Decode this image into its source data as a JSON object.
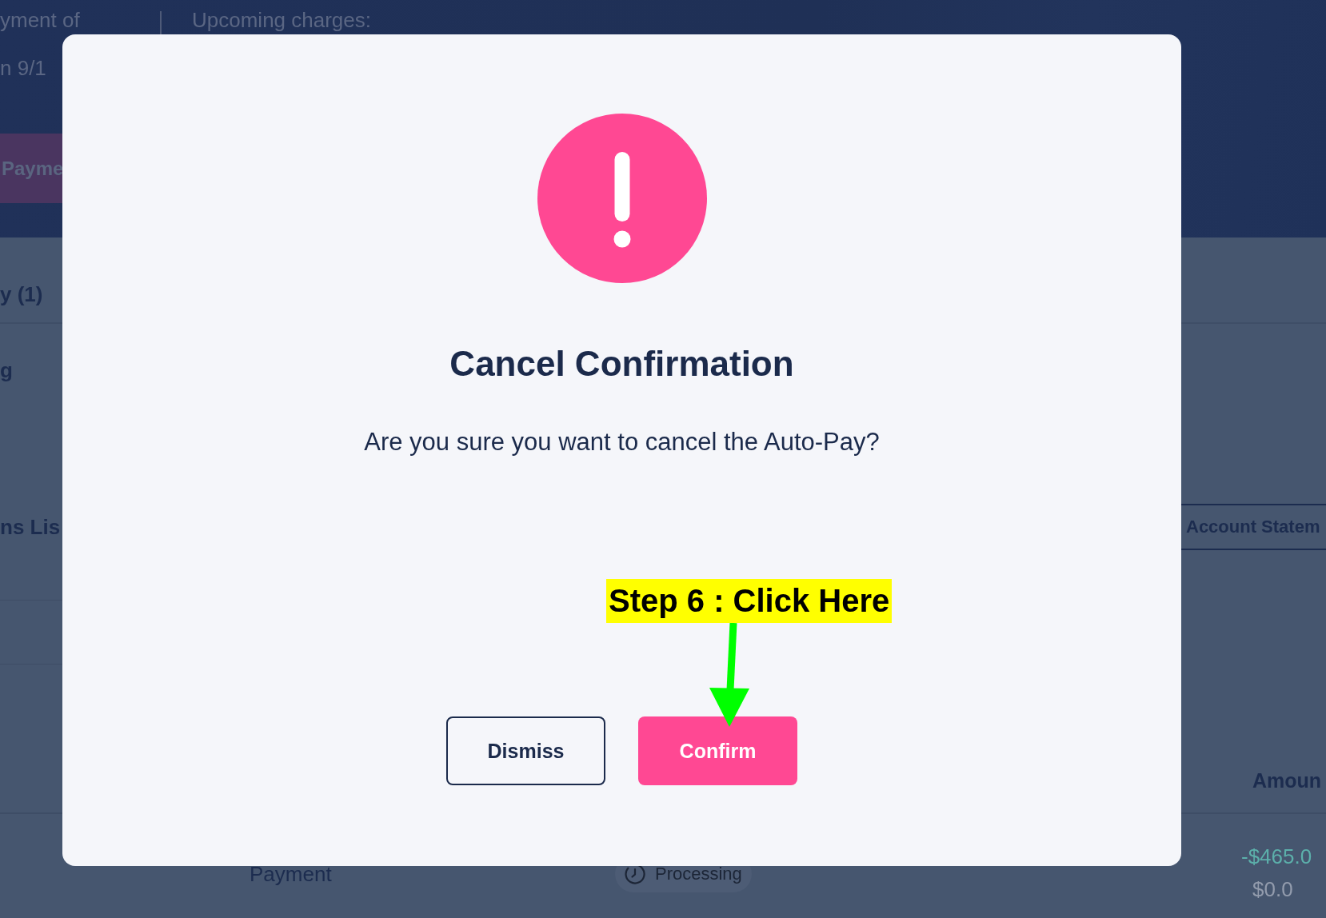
{
  "page": {
    "header": {
      "payment_info_lines": [
        "yment of",
        "n 9/1"
      ],
      "upcoming_label": "Upcoming charges:",
      "pay_button": "Payme"
    },
    "tabs": [
      {
        "label": "y (1)"
      }
    ],
    "filter_label": "g",
    "section_title": "ns Lis",
    "statement_button": "Account Statem",
    "table": {
      "columns": [
        "Amoun"
      ],
      "rows": [
        {
          "column_1": "Payment",
          "column_2": "Processing",
          "column_3": [
            "-$465.0",
            "$0.0"
          ]
        }
      ]
    }
  },
  "dialog": {
    "title": "Cancel Confirmation",
    "message": "Are you sure you want to cancel the Auto-Pay?",
    "buttons": [
      {
        "label": "Dismiss",
        "kind": "secondary"
      },
      {
        "label": "Confirm",
        "kind": "primary"
      }
    ]
  },
  "annotation": {
    "text": "Step 6 : Click Here"
  }
}
